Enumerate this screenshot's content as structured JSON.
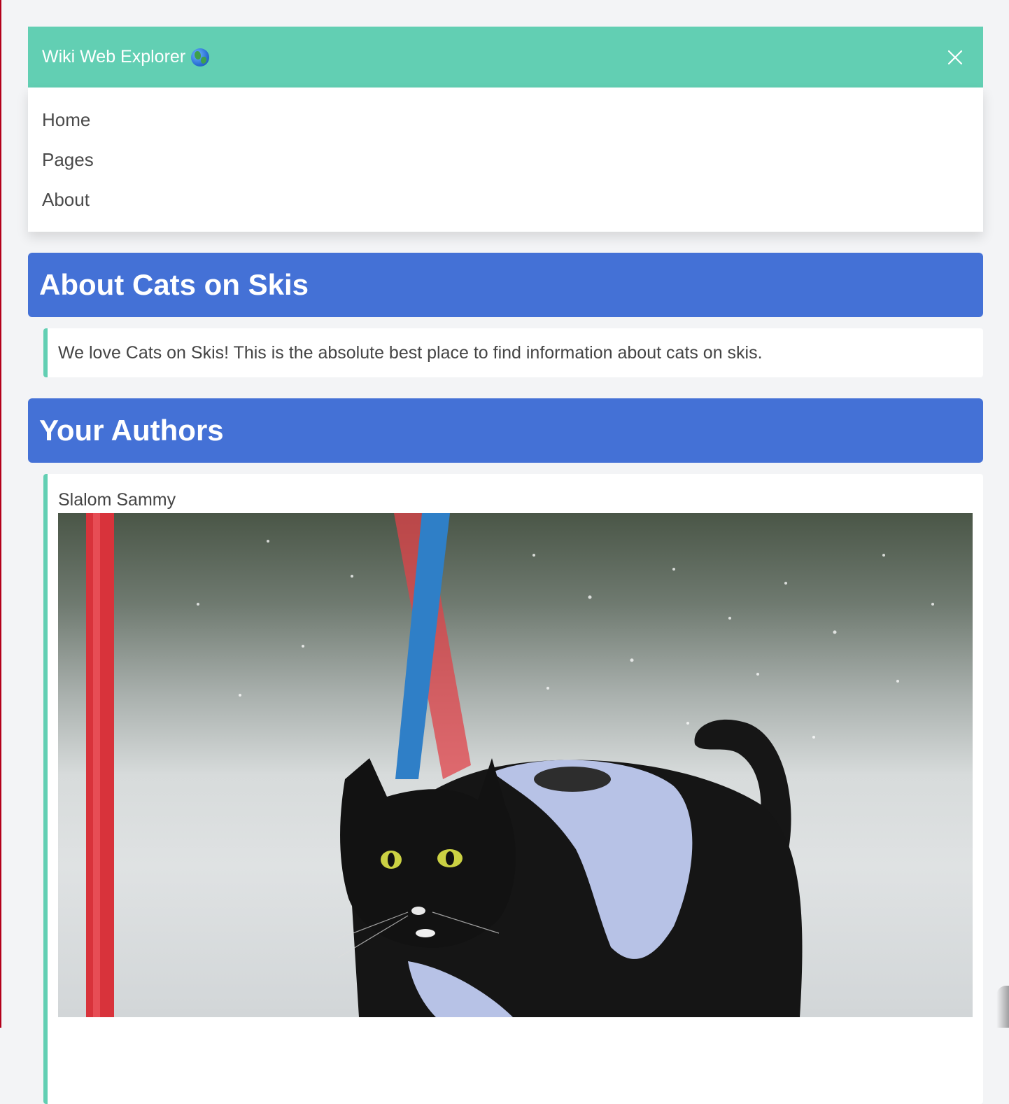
{
  "navbar": {
    "brand": "Wiki Web Explorer",
    "brand_icon": "globe-icon",
    "close_icon": "close-icon",
    "background": "#62cfb3"
  },
  "menu": {
    "items": [
      {
        "label": "Home"
      },
      {
        "label": "Pages"
      },
      {
        "label": "About"
      }
    ]
  },
  "about": {
    "title": "About Cats on Skis",
    "text": "We love Cats on Skis! This is the absolute best place to find information about cats on skis."
  },
  "authors": {
    "title": "Your Authors",
    "list": [
      {
        "name": "Slalom Sammy",
        "photo_icon": "cat-skiing-photo"
      }
    ]
  },
  "colors": {
    "accent": "#62cfb3",
    "header_blue": "#4471d6",
    "page_background": "#f3f4f6"
  }
}
